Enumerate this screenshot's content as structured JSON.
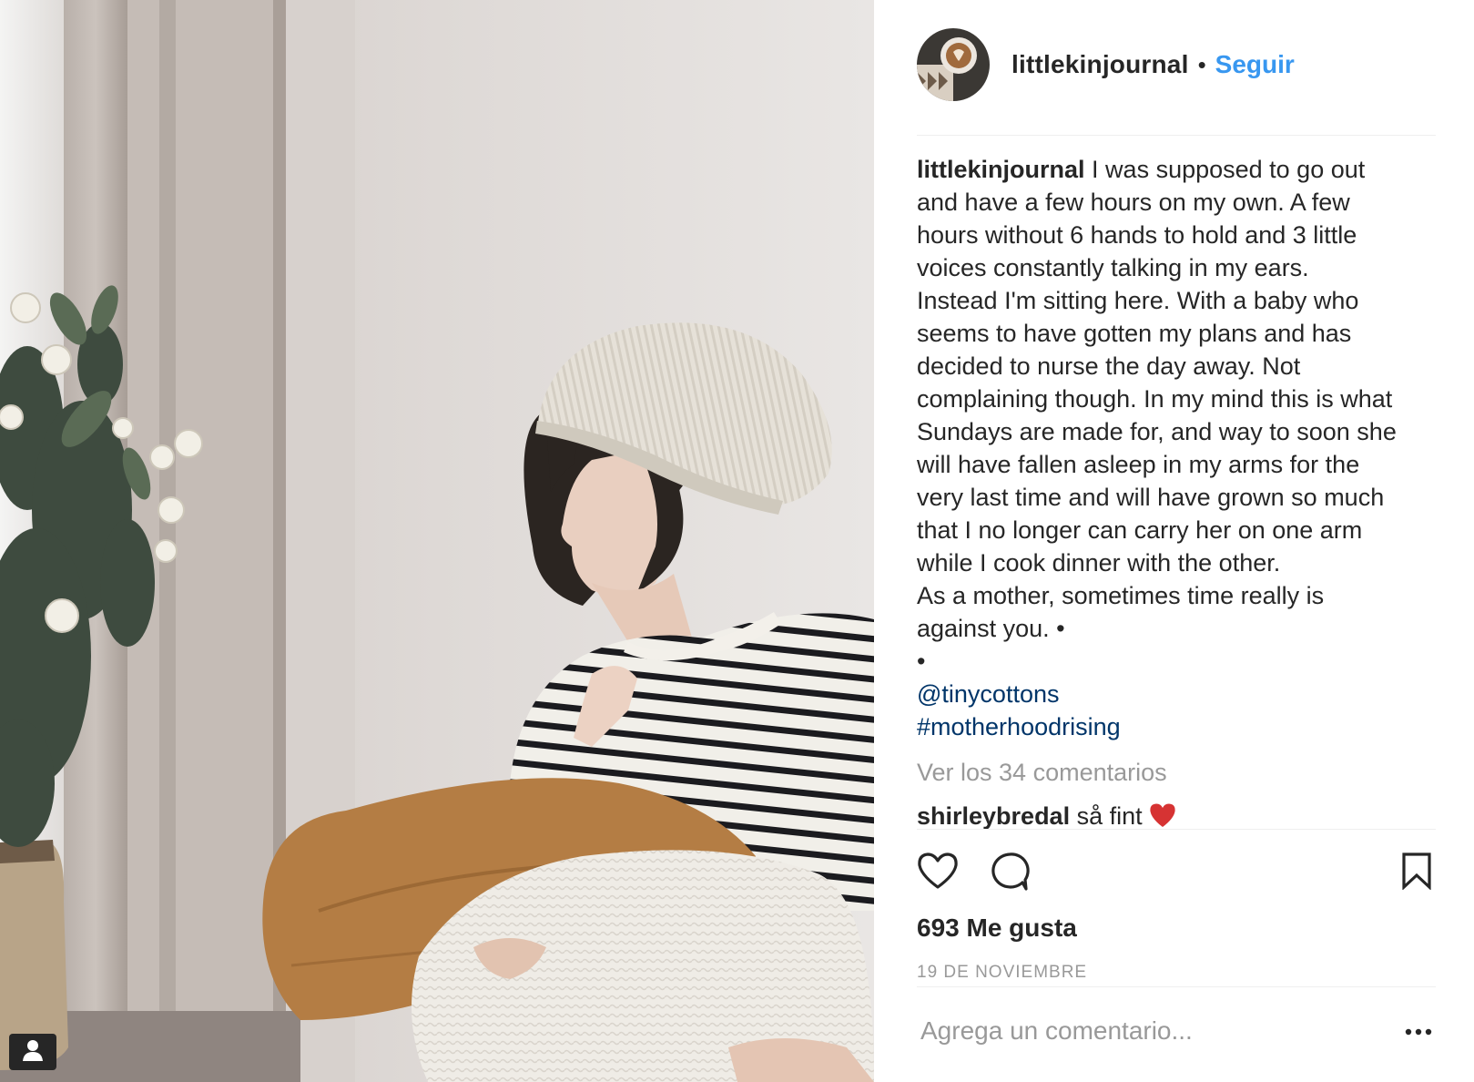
{
  "post": {
    "username": "littlekinjournal",
    "header_separator": "•",
    "follow_label": "Seguir",
    "caption_lines": [
      "I was supposed to go out",
      "and have a few hours on my own. A few",
      "hours without 6 hands to hold and 3 little",
      "voices constantly talking in my ears.",
      "Instead I'm sitting here. With a baby who",
      "seems to have gotten my plans and has",
      "decided to nurse the day away. Not",
      "complaining though. In my mind this is what",
      "Sundays are made for, and way to soon she",
      "will have fallen asleep in my arms for the",
      "very last time and will have grown so much",
      "that I no longer can carry her on one arm",
      "while I cook dinner with the other.",
      "As a mother, sometimes time really is",
      "against you. •",
      "•"
    ],
    "mention": "@tinycottons",
    "hashtag": "#motherhoodrising",
    "view_comments_label": "Ver los 34 comentarios",
    "first_comment": {
      "username": "shirleybredal",
      "text": "så fint"
    },
    "likes_label": "693 Me gusta",
    "date_label": "19 DE NOVIEMBRE",
    "comment_placeholder": "Agrega un comentario...",
    "more_label": "•••"
  },
  "icons": {
    "like": "heart-outline-icon",
    "comment": "speech-bubble-icon",
    "save": "bookmark-icon",
    "tag": "person-tag-icon",
    "more": "ellipsis-icon"
  },
  "colors": {
    "link": "#003569",
    "follow": "#3897f0",
    "muted": "#999999",
    "text": "#262626",
    "divider": "#efefef"
  }
}
